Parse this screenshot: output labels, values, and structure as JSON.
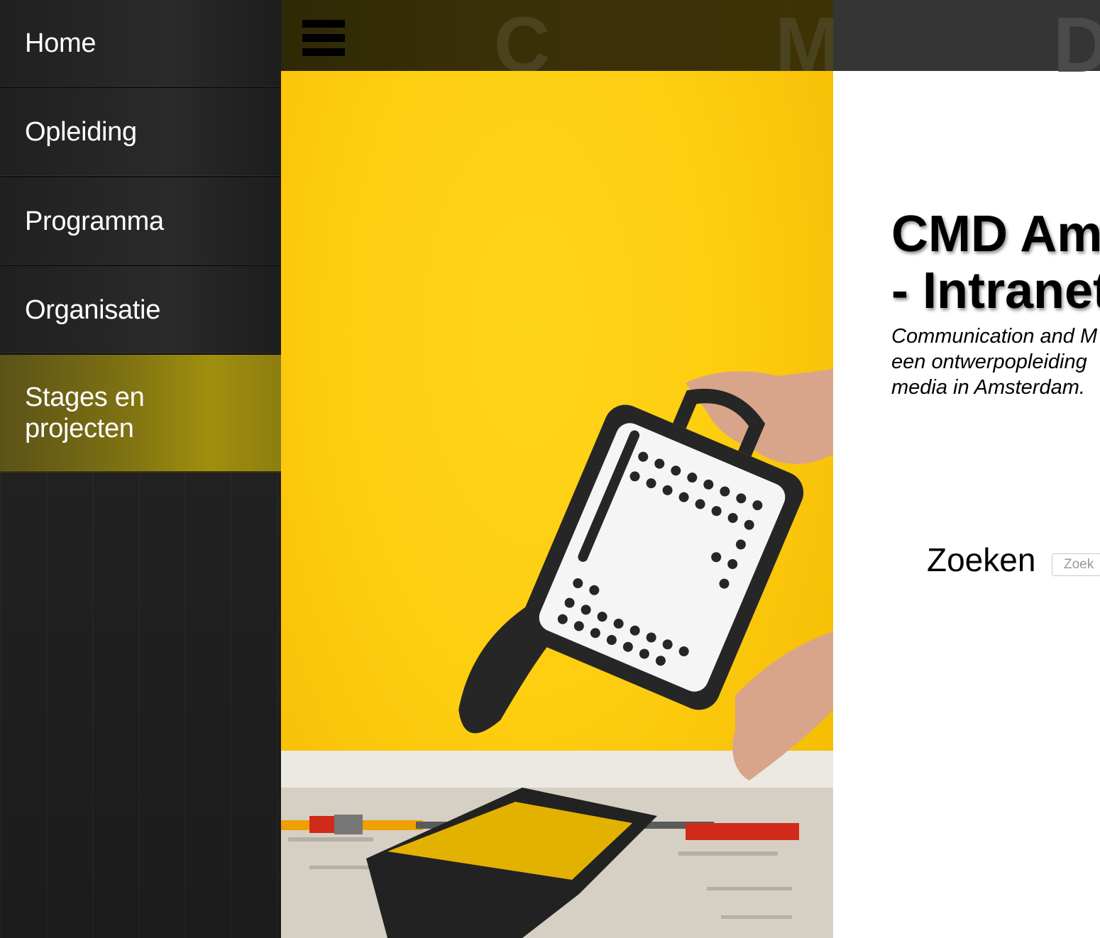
{
  "sidebar": {
    "items": [
      {
        "label": "Home"
      },
      {
        "label": "Opleiding"
      },
      {
        "label": "Programma"
      },
      {
        "label": "Organisatie"
      },
      {
        "label": "Stages en projecten",
        "active": true
      }
    ]
  },
  "header": {
    "logo_letters": [
      "C",
      "M",
      "D"
    ]
  },
  "main": {
    "title_line1": "CMD Am",
    "title_line2": "- Intranet",
    "subtitle_lines": [
      "Communication and M",
      "een ontwerpopleiding",
      "media in Amsterdam."
    ],
    "search_label": "Zoeken",
    "search_placeholder": "Zoek"
  },
  "colors": {
    "sidebar_bg": "#232323",
    "active_item": "#8c7d10",
    "photo_yellow": "#fecd10",
    "topbar_right": "#353535"
  },
  "icons": [
    "menu-icon"
  ]
}
